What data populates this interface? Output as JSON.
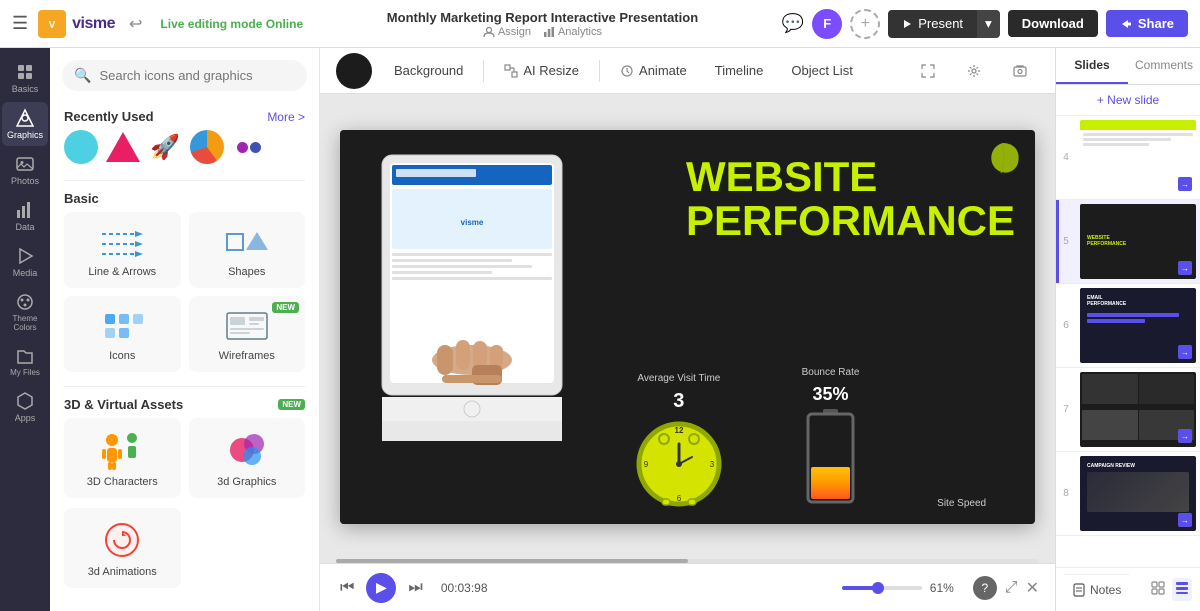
{
  "app": {
    "name": "visme",
    "menu_icon": "☰",
    "undo_icon": "↩"
  },
  "topbar": {
    "live_editing_label": "Live editing mode",
    "online_status": "Online",
    "title": "Monthly Marketing Report Interactive Presentation",
    "assign_label": "Assign",
    "analytics_label": "Analytics",
    "present_label": "Present",
    "download_label": "Download",
    "share_label": "Share",
    "avatar_initials": "F"
  },
  "sidebar": {
    "items": [
      {
        "id": "basics",
        "label": "Basics",
        "icon": "⊞"
      },
      {
        "id": "graphics",
        "label": "Graphics",
        "icon": "◈",
        "active": true
      },
      {
        "id": "photos",
        "label": "Photos",
        "icon": "🖼"
      },
      {
        "id": "data",
        "label": "Data",
        "icon": "◑"
      },
      {
        "id": "media",
        "label": "Media",
        "icon": "▶"
      },
      {
        "id": "theme-colors",
        "label": "Theme Colors",
        "icon": "🎨"
      },
      {
        "id": "my-files",
        "label": "My Files",
        "icon": "📁"
      },
      {
        "id": "apps",
        "label": "Apps",
        "icon": "⬡"
      }
    ]
  },
  "graphics_panel": {
    "search_placeholder": "Search icons and graphics",
    "recently_used_label": "Recently Used",
    "more_label": "More >",
    "basic_label": "Basic",
    "categories": [
      {
        "id": "lines-arrows",
        "label": "Line & Arrows",
        "icon": "lines"
      },
      {
        "id": "shapes",
        "label": "Shapes",
        "icon": "shapes"
      },
      {
        "id": "icons",
        "label": "Icons",
        "icon": "icons"
      },
      {
        "id": "wireframes",
        "label": "Wireframes",
        "icon": "wireframes",
        "new": true
      }
    ],
    "threed_label": "3D & Virtual Assets",
    "threed_new": true,
    "threed_categories": [
      {
        "id": "3d-characters",
        "label": "3D Characters",
        "icon": "3dchar"
      },
      {
        "id": "3d-graphics",
        "label": "3d Graphics",
        "icon": "3dgfx"
      },
      {
        "id": "3d-animations",
        "label": "3d Animations",
        "icon": "3danim"
      }
    ]
  },
  "canvas_toolbar": {
    "background_label": "Background",
    "ai_resize_label": "AI Resize",
    "animate_label": "Animate",
    "timeline_label": "Timeline",
    "object_list_label": "Object List"
  },
  "slide_content": {
    "title_line1": "WEBSITE",
    "title_line2": "PERFORMANCE",
    "metric1_label": "Average Visit Time",
    "metric1_value": "3",
    "metric2_label": "Bounce Rate",
    "metric2_value": "35%",
    "metric3_label": "Site Speed"
  },
  "bottom_bar": {
    "time": "00:03:98",
    "zoom_percent": "61%",
    "notes_label": "Notes"
  },
  "slides_panel": {
    "slides_tab": "Slides",
    "comments_tab": "Comments",
    "new_slide_label": "+ New slide",
    "slides": [
      {
        "num": "4",
        "type": "light"
      },
      {
        "num": "5",
        "type": "dark",
        "active": true
      },
      {
        "num": "6",
        "type": "dark"
      },
      {
        "num": "7",
        "type": "grid"
      },
      {
        "num": "8",
        "type": "campaign"
      }
    ],
    "notes_label": "Notes"
  }
}
